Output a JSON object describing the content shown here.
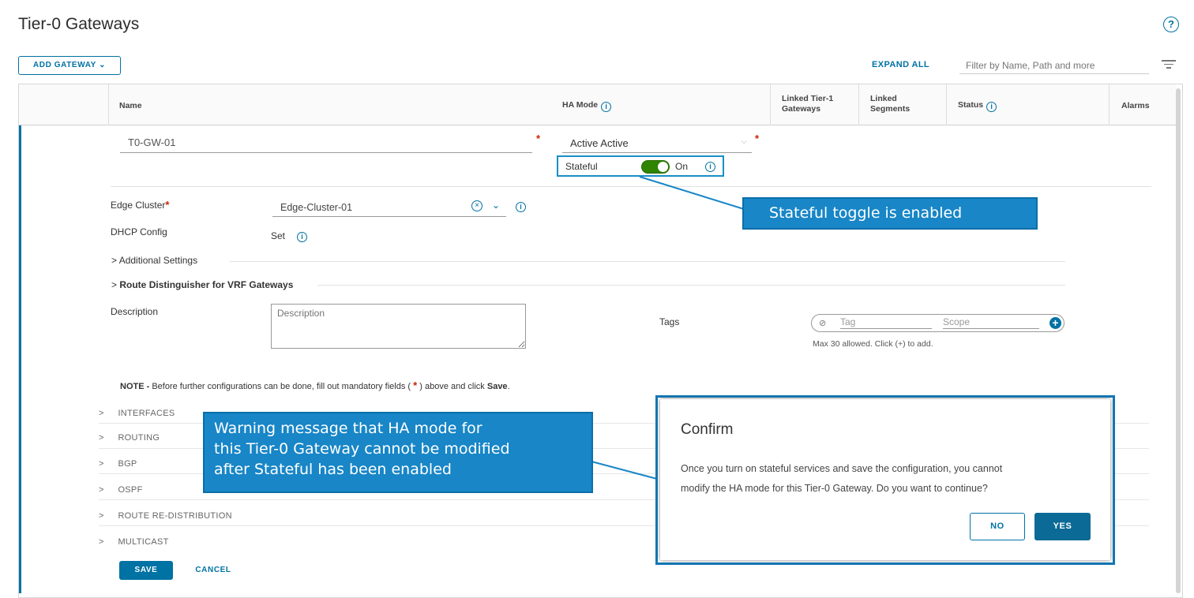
{
  "header": {
    "title": "Tier-0 Gateways",
    "help_icon": "?"
  },
  "toolbar": {
    "add_gateway_label": "ADD GATEWAY",
    "add_gateway_caret": "⌄",
    "expand_all_label": "EXPAND ALL",
    "filter_placeholder": "Filter by Name, Path and more"
  },
  "table": {
    "columns": {
      "name": "Name",
      "ha_mode": "HA Mode",
      "linked_tier1_line1": "Linked Tier-1",
      "linked_tier1_line2": "Gateways",
      "linked_segments_line1": "Linked",
      "linked_segments_line2": "Segments",
      "status": "Status",
      "alarms": "Alarms"
    },
    "info_glyph": "i"
  },
  "form": {
    "name_value": "T0-GW-01",
    "required_mark": "*",
    "ha_mode_value": "Active Active",
    "stateful_label": "Stateful",
    "stateful_state": "On",
    "edge_cluster_label": "Edge Cluster",
    "edge_cluster_value": "Edge-Cluster-01",
    "dhcp_label": "DHCP Config",
    "dhcp_value": "Set",
    "additional_settings": "Additional Settings",
    "route_distinguisher": "Route Distinguisher for VRF Gateways",
    "description_label": "Description",
    "description_placeholder": "Description",
    "tags_label": "Tags",
    "tag_placeholder": "Tag",
    "scope_placeholder": "Scope",
    "tags_hint": "Max 30 allowed. Click (+) to add.",
    "note_prefix": "NOTE -",
    "note_text": " Before further configurations can be done, fill out mandatory fields ( ",
    "note_star": "*",
    "note_text2": " ) above and click ",
    "note_save": "Save",
    "note_end": "."
  },
  "sections": [
    "INTERFACES",
    "ROUTING",
    "BGP",
    "OSPF",
    "ROUTE RE-DISTRIBUTION",
    "MULTICAST"
  ],
  "actions": {
    "save_label": "SAVE",
    "cancel_label": "CANCEL"
  },
  "callouts": {
    "stateful": "Stateful toggle is enabled",
    "warning_line1": "Warning message that HA mode for",
    "warning_line2": "this Tier-0 Gateway cannot be modified",
    "warning_line3": "after Stateful has been enabled"
  },
  "dialog": {
    "title": "Confirm",
    "body_line1": "Once you turn on stateful services and save the configuration, you cannot",
    "body_line2": "modify the HA mode for this Tier-0 Gateway. Do you want to continue?",
    "no_label": "NO",
    "yes_label": "YES"
  },
  "colors": {
    "accent": "#0072a3",
    "callout": "#1886c7",
    "toggle_on": "#2f8400",
    "required": "#c92100"
  }
}
